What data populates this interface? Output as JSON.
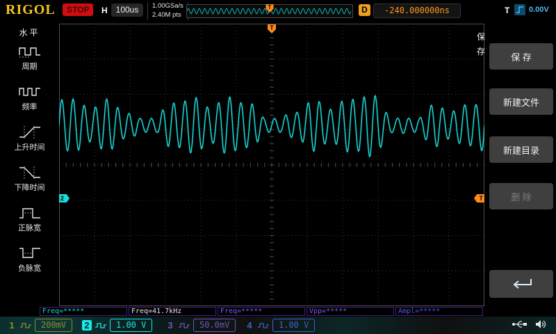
{
  "colors": {
    "logo": "#f5c518",
    "trigger_orange": "#ff8c1a",
    "ch1": "#8f8f28",
    "ch2": "#1ce8e8",
    "ch3": "#7a50b4",
    "ch4": "#3c64c8"
  },
  "top_bar": {
    "logo": "RIGOL",
    "run_state": "STOP",
    "horizontal_label": "H",
    "timebase": "100us",
    "sample_rate": "1.00GSa/s",
    "memory_depth": "2.40M pts",
    "delay_label": "D",
    "delay_value": "-240.000000ns",
    "trigger_label": "T",
    "trigger_level": "0.00V"
  },
  "sidebar": {
    "title": "水平",
    "items": [
      {
        "label": "周期",
        "icon": "period-icon"
      },
      {
        "label": "频率",
        "icon": "frequency-icon"
      },
      {
        "label": "上升时间",
        "icon": "rise-time-icon"
      },
      {
        "label": "下降时间",
        "icon": "fall-time-icon"
      },
      {
        "label": "正脉宽",
        "icon": "positive-pulse-width-icon"
      },
      {
        "label": "负脉宽",
        "icon": "negative-pulse-width-icon"
      }
    ]
  },
  "menu": {
    "tab": "保存",
    "tab_chars": [
      "保",
      "存"
    ],
    "buttons": {
      "save": "保 存",
      "new_file": "新建文件",
      "new_folder": "新建目录",
      "delete": "删 除"
    }
  },
  "markers": {
    "trigger_label": "T",
    "channel2_label": "2"
  },
  "measurements": [
    {
      "text": "Freq=*****",
      "color": "#10d6d6"
    },
    {
      "text": "Freq=41.7kHz",
      "color": "#e6e6e6"
    },
    {
      "text": "Freq=*****",
      "color": "#7a5cf0"
    },
    {
      "text": "Vpp=*****",
      "color": "#7a5cf0"
    },
    {
      "text": "Ampl=*****",
      "color": "#4a5ae8"
    }
  ],
  "channels": [
    {
      "number": "1",
      "scale": "200mV",
      "color": "#8f8f28",
      "active": false
    },
    {
      "number": "2",
      "scale": "1.00 V",
      "color": "#1ce8e8",
      "active": true
    },
    {
      "number": "3",
      "scale": "50.0mV",
      "color": "#7a50b4",
      "active": false
    },
    {
      "number": "4",
      "scale": "1.00 V",
      "color": "#3c64c8",
      "active": false
    }
  ],
  "grid": {
    "cols": 12,
    "rows": 8
  },
  "waveform": {
    "color": "#1ce8e8",
    "carrier_cycles": 38,
    "center_frac": 0.36,
    "base_amp": 26,
    "mod1_amp": 13,
    "mod1_cycles": 3.1,
    "mod2_amp": 9,
    "mod2_cycles": 6.7,
    "mod3_amp": 5,
    "mod3_cycles": 14.3
  }
}
